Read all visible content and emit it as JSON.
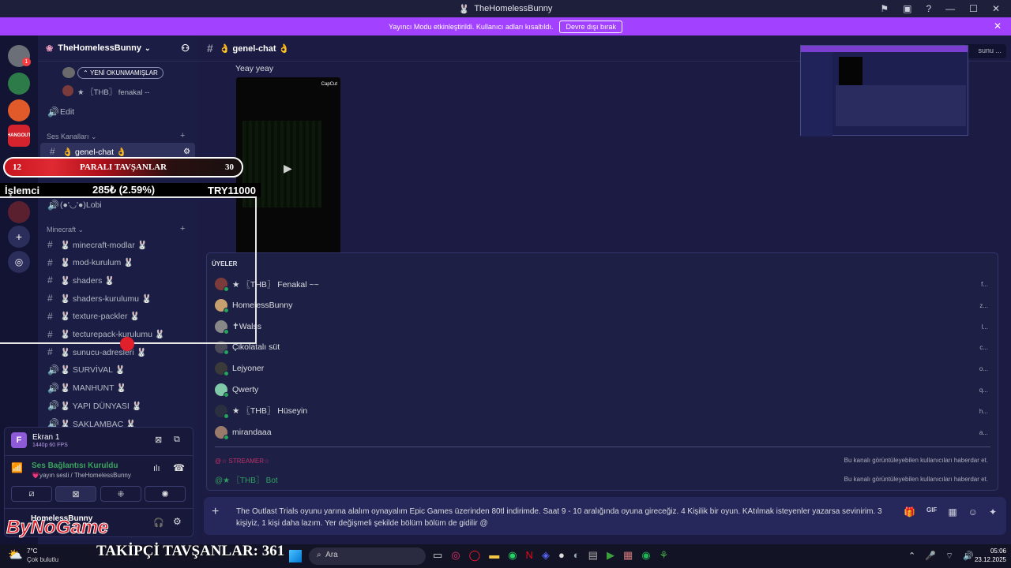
{
  "titlebar": {
    "title": "TheHomelessBunny"
  },
  "banner": {
    "text": "Yayıncı Modu etkinleştirildi. Kullanıcı adları kısaltıldı.",
    "button": "Devre dışı bırak"
  },
  "rail": {
    "badge": "1",
    "hangout": "HANGOUT"
  },
  "sidebar": {
    "server_name": "TheHomelessBunny",
    "unread_pill": "YENİ OKUNMAMIŞLAR",
    "dm_user": "★ 〖THB〗 fenakal --",
    "edit": "Edit",
    "cat_voice": "Ses Kanalları",
    "genel_chat": "👌 genel-chat 👌",
    "lobi": "(●'◡'●)Lobi",
    "cat_minecraft": "Minecraft",
    "channels": [
      {
        "icon": "#",
        "label": "🐰 minecraft-modlar 🐰"
      },
      {
        "icon": "#",
        "label": "🐰 mod-kurulum 🐰"
      },
      {
        "icon": "#",
        "label": "🐰 shaders 🐰"
      },
      {
        "icon": "#",
        "label": "🐰 shaders-kurulumu 🐰"
      },
      {
        "icon": "#",
        "label": "🐰 texture-packler 🐰"
      },
      {
        "icon": "#",
        "label": "🐰 tecturepack-kurulumu 🐰"
      },
      {
        "icon": "#",
        "label": "🐰 sunucu-adresleri 🐰"
      },
      {
        "icon": "🔊",
        "label": "🐰 SURVİVAL 🐰"
      },
      {
        "icon": "🔊",
        "label": "🐰 MANHUNT 🐰"
      },
      {
        "icon": "🔊",
        "label": "🐰 YAPI DÜNYASI 🐰"
      },
      {
        "icon": "🔊",
        "label": "🐰 SAKLAMBAÇ 🐰"
      }
    ]
  },
  "panel": {
    "screen_title": "Ekran 1",
    "screen_sub": "1440p 60 FPS",
    "voice_status": "Ses Bağlantısı Kuruldu",
    "voice_sub": "💗yayın sesli / TheHomelessBunny",
    "user": "HomelessBunny"
  },
  "overlay": {
    "left_num": "12",
    "title": "PARALI TAVŞANLAR",
    "right_num": "30",
    "name": "İşlemci",
    "amount": "285₺ (2.59%)",
    "goal": "TRY11000",
    "followers": "TAKİPÇİ TAVŞANLAR: 361",
    "logo": "ByNoGame"
  },
  "main": {
    "channel": "👌 genel-chat 👌",
    "msg": "Yeay yeay",
    "capcut": "CapCut",
    "search": "sunu ...",
    "members_title": "ÜYELER",
    "members": [
      {
        "name": "★ 〖THB〗 Fenakal ~~",
        "right": "f...",
        "color": "#7b3b3b"
      },
      {
        "name": "HomelessBunny",
        "right": "z...",
        "color": "#c8a070"
      },
      {
        "name": "✝Walss",
        "right": "l...",
        "color": "#888888"
      },
      {
        "name": "Çikolatalı süt",
        "right": "c...",
        "color": "#4a4a5a"
      },
      {
        "name": "Lejyoner",
        "right": "o...",
        "color": "#3a3a3a"
      },
      {
        "name": "Qwerty",
        "right": "q...",
        "color": "#7fc8a8"
      },
      {
        "name": "★ 〖THB〗 Hüseyin",
        "right": "h...",
        "color": "#2a3040"
      },
      {
        "name": "mirandaaa",
        "right": "a...",
        "color": "#9a7a6a"
      }
    ],
    "role1": "@☆ STREAMER☆",
    "role1_note": "Bu kanalı görüntüleyebilen kullanıcıları haberdar et.",
    "role2": "@★ 〖THB〗 Bot",
    "role2_note": "Bu kanalı görüntüleyebilen kullanıcıları haberdar et.",
    "composer": "The Outlast Trials oyunu yarına alalım oynayalım Epic Games üzerinden 80tl indirimde. Saat 9 - 10 aralığında oyuna gireceğiz. 4 Kişilik bir oyun. KAtılmak isteyenler yazarsa sevinirim. 3 kişiyiz, 1 kişi daha lazım. Yer değişmeli şekilde bölüm bölüm de gidilir @"
  },
  "taskbar": {
    "temp": "7°C",
    "weather": "Çok bulutlu",
    "search": "Ara",
    "time": "05:06",
    "date": "23.12.2025"
  }
}
